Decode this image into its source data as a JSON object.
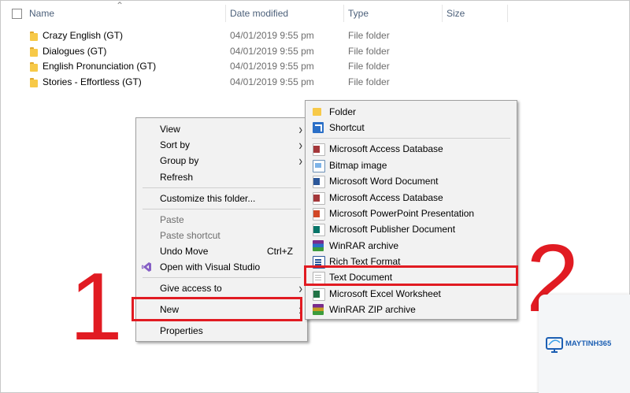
{
  "header": {
    "name": "Name",
    "date_modified": "Date modified",
    "type": "Type",
    "size": "Size"
  },
  "files": [
    {
      "name": "Crazy English (GT)",
      "date": "04/01/2019 9:55 pm",
      "type": "File folder"
    },
    {
      "name": "Dialogues (GT)",
      "date": "04/01/2019 9:55 pm",
      "type": "File folder"
    },
    {
      "name": "English Pronunciation (GT)",
      "date": "04/01/2019 9:55 pm",
      "type": "File folder"
    },
    {
      "name": "Stories - Effortless (GT)",
      "date": "04/01/2019 9:55 pm",
      "type": "File folder"
    }
  ],
  "context_menu": {
    "view": "View",
    "sort_by": "Sort by",
    "group_by": "Group by",
    "refresh": "Refresh",
    "customize": "Customize this folder...",
    "paste": "Paste",
    "paste_shortcut": "Paste shortcut",
    "undo_move": "Undo Move",
    "undo_shortcut": "Ctrl+Z",
    "open_vs": "Open with Visual Studio",
    "give_access": "Give access to",
    "new": "New",
    "properties": "Properties"
  },
  "new_submenu": {
    "folder": "Folder",
    "shortcut": "Shortcut",
    "items": [
      {
        "label": "Microsoft Access Database",
        "icon": "access-icon"
      },
      {
        "label": "Bitmap image",
        "icon": "bitmap-icon"
      },
      {
        "label": "Microsoft Word Document",
        "icon": "word-icon"
      },
      {
        "label": "Microsoft Access Database",
        "icon": "access-icon"
      },
      {
        "label": "Microsoft PowerPoint Presentation",
        "icon": "powerpoint-icon"
      },
      {
        "label": "Microsoft Publisher Document",
        "icon": "publisher-icon"
      },
      {
        "label": "WinRAR archive",
        "icon": "winrar-icon"
      },
      {
        "label": "Rich Text Format",
        "icon": "rtf-icon"
      },
      {
        "label": "Text Document",
        "icon": "text-document-icon"
      },
      {
        "label": "Microsoft Excel Worksheet",
        "icon": "excel-icon"
      },
      {
        "label": "WinRAR ZIP archive",
        "icon": "winrar-zip-icon"
      }
    ]
  },
  "annotations": {
    "step1": "1",
    "step2": "2",
    "highlight_color": "#e11b22"
  },
  "watermark": {
    "brand": "MAYTINH365"
  }
}
